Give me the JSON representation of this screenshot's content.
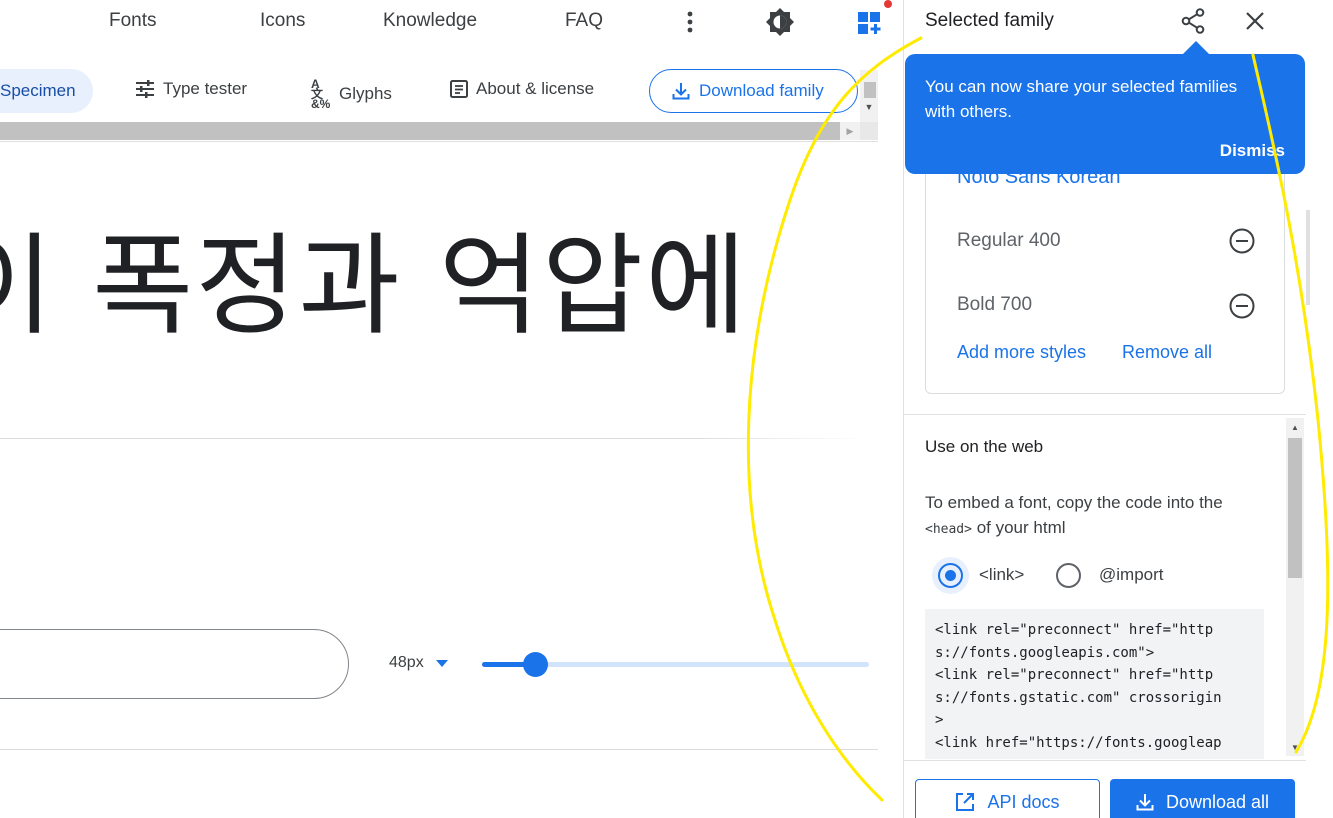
{
  "topnav": {
    "links": [
      "Fonts",
      "Icons",
      "Knowledge",
      "FAQ"
    ],
    "icons": [
      "more-vert-icon",
      "brightness-icon",
      "selected-families-icon"
    ]
  },
  "subnav": {
    "tabs": [
      "Specimen",
      "Type tester",
      "Glyphs",
      "About & license"
    ],
    "download_family": "Download family"
  },
  "specimen": {
    "text": "이 폭정과 억압에"
  },
  "controls": {
    "size": "48px",
    "size_value": 48
  },
  "drawer": {
    "title": "Selected family",
    "tooltip": {
      "message": "You can now share your selected families with others.",
      "dismiss": "Dismiss"
    },
    "family": {
      "name": "Noto Sans Korean",
      "styles": [
        "Regular 400",
        "Bold 700"
      ],
      "add_more": "Add more styles",
      "remove_all": "Remove all"
    },
    "web": {
      "title": "Use on the web",
      "embed_before": "To embed a font, copy the code into the",
      "embed_code": "<head>",
      "embed_after": "of your html",
      "options": [
        "<link>",
        "@import"
      ],
      "selected_option": "<link>",
      "code_lines": [
        "<link rel=\"preconnect\" href=\"http",
        "s://fonts.googleapis.com\">",
        "<link rel=\"preconnect\" href=\"http",
        "s://fonts.gstatic.com\" crossorigin",
        ">",
        "<link href=\"https://fonts.googleap"
      ]
    },
    "buttons": {
      "api_docs": "API docs",
      "download_all": "Download all"
    }
  },
  "colors": {
    "accent": "#1a73e8",
    "annotation": "#ffeb00",
    "notification_dot": "#e53935"
  }
}
